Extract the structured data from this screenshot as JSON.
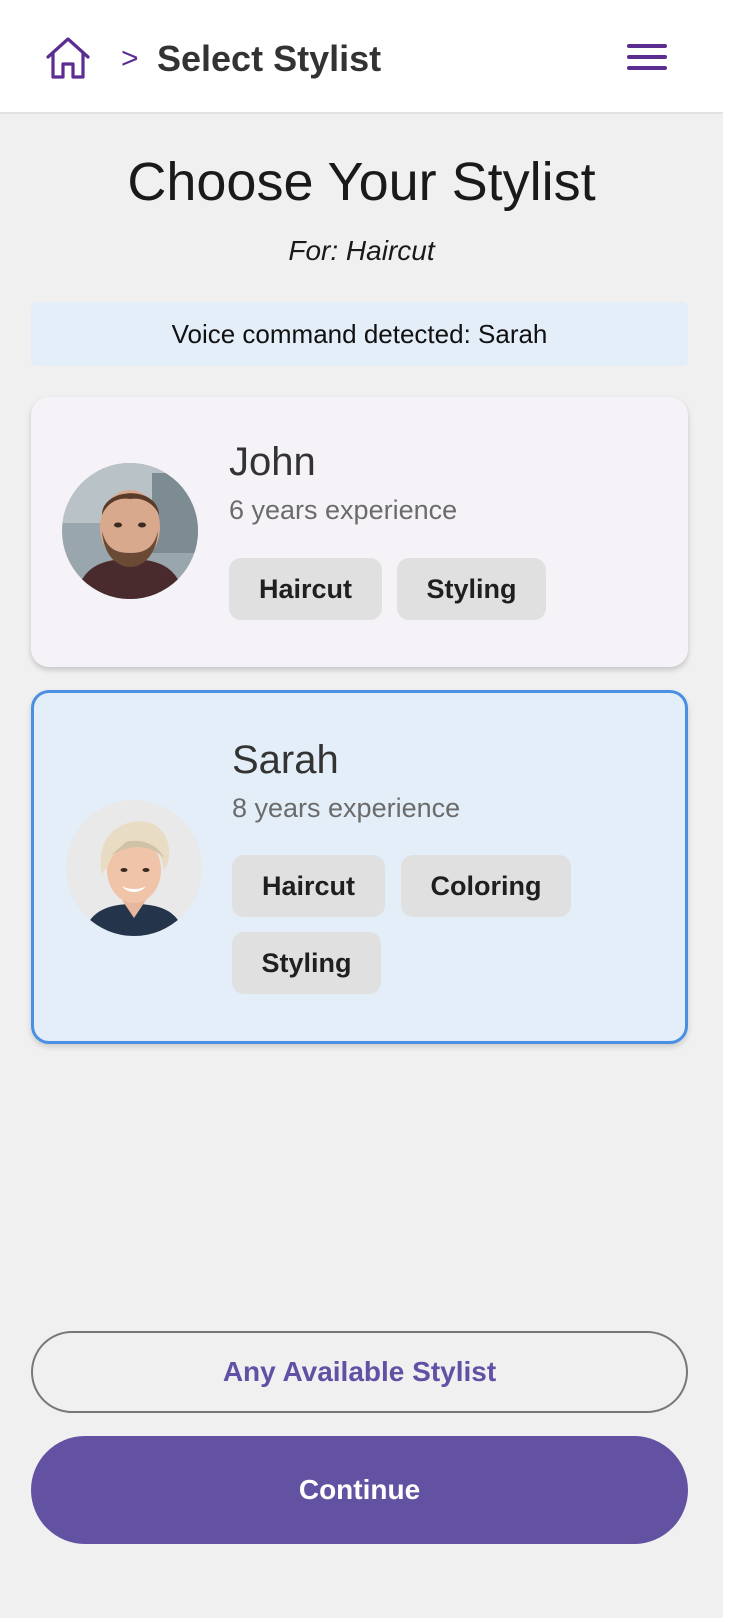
{
  "header": {
    "home_icon": "home-icon",
    "separator": ">",
    "title": "Select Stylist",
    "menu_icon": "hamburger-menu-icon"
  },
  "page": {
    "title": "Choose Your Stylist",
    "subtitle": "For: Haircut"
  },
  "voice_banner": {
    "text": "Voice command detected: Sarah"
  },
  "stylists": [
    {
      "name": "John",
      "experience": "6 years experience",
      "tags": [
        "Haircut",
        "Styling"
      ],
      "selected": false
    },
    {
      "name": "Sarah",
      "experience": "8 years experience",
      "tags": [
        "Haircut",
        "Coloring",
        "Styling"
      ],
      "selected": true
    }
  ],
  "actions": {
    "any_stylist": "Any Available Stylist",
    "continue": "Continue"
  },
  "colors": {
    "brand_purple": "#5c2d91",
    "button_purple": "#6351a2",
    "selected_border": "#4a90e2",
    "banner_bg": "#e3eef8",
    "page_bg": "#f0f0f0"
  }
}
